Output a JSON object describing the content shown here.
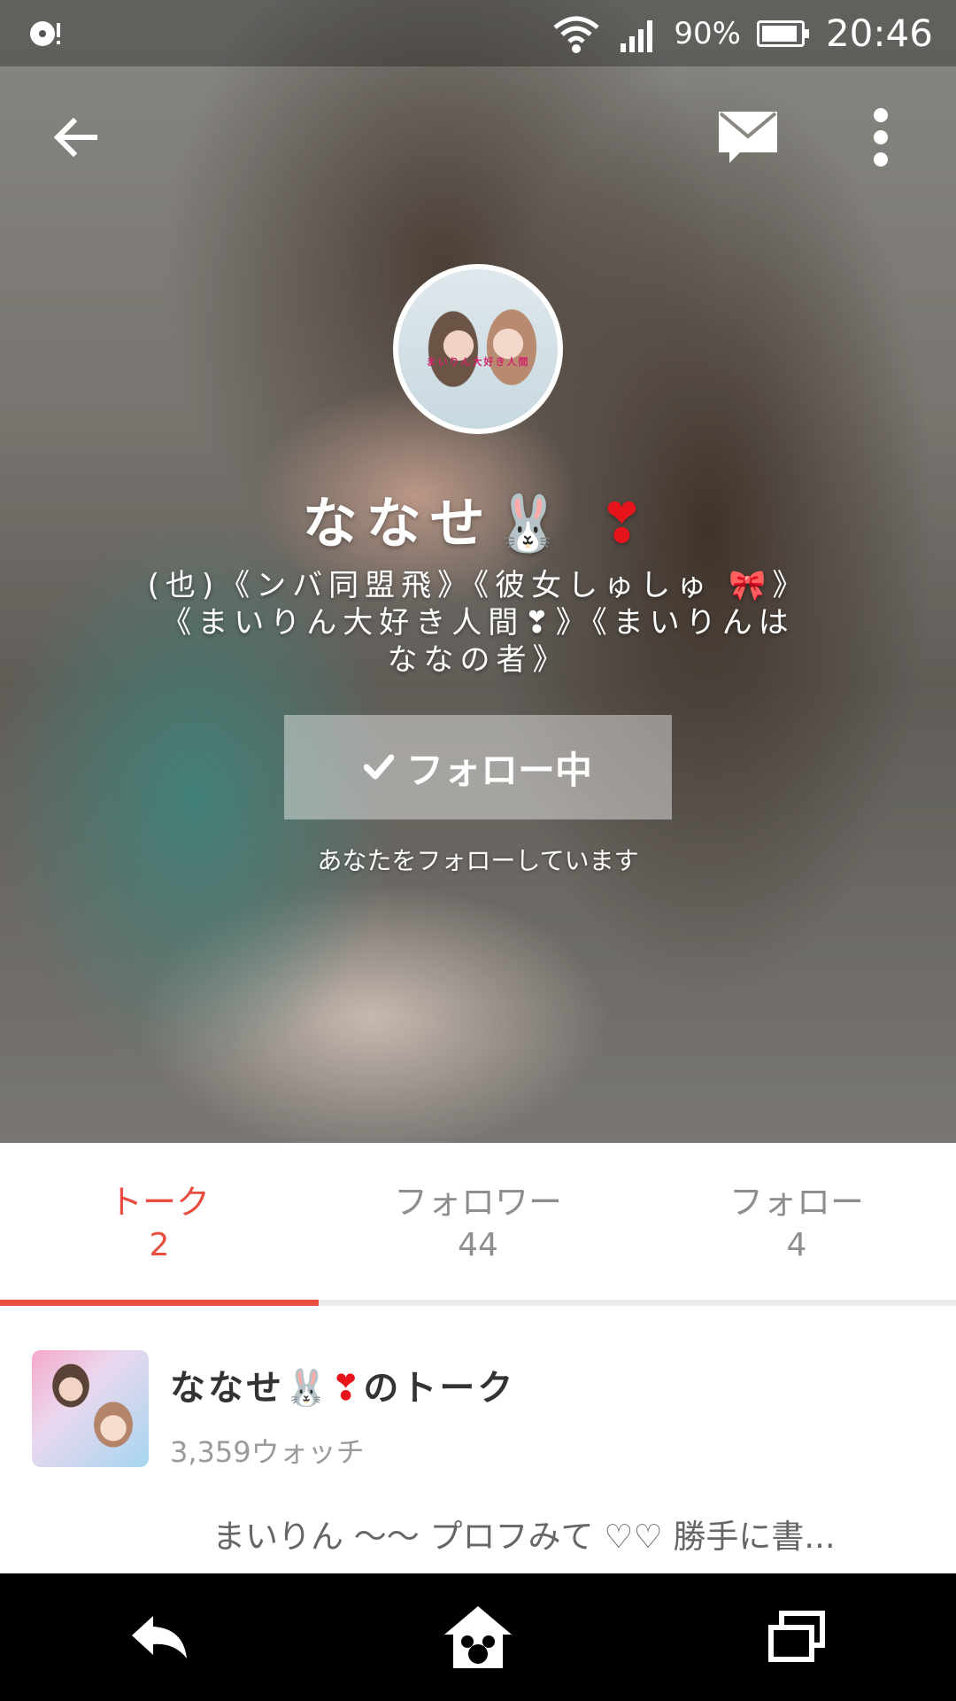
{
  "status_bar": {
    "battery_text": "90%",
    "time": "20:46"
  },
  "toolbar": {
    "back_icon": "arrow-left-icon",
    "message_icon": "mail-icon",
    "more_icon": "more-vertical-icon"
  },
  "profile": {
    "avatar_caption": "まいりん大好き人間",
    "name": "ななせ🐰",
    "name_heart": "❣",
    "bio_line1": "(也)《ンバ同盟飛》《彼女しゅしゅ 🎀》",
    "bio_line2": "《まいりん大好き人間❣》《まいりんは",
    "bio_line3": "ななの者》",
    "follow_button_label": "フォロー中",
    "follows_you_text": "あなたをフォローしています"
  },
  "tabs": [
    {
      "label": "トーク",
      "count": "2"
    },
    {
      "label": "フォロワー",
      "count": "44"
    },
    {
      "label": "フォロー",
      "count": "4"
    }
  ],
  "talk": {
    "title_prefix": "ななせ🐰",
    "title_heart": "❣",
    "title_suffix": "のトーク",
    "watch_count": "3,359ウォッチ",
    "snippet": "まいりん 〜〜 プロフみて ♡♡ 勝手に書..."
  },
  "colors": {
    "accent": "#e94d3f",
    "nav_background": "#000000",
    "heart": "#e8141c"
  }
}
